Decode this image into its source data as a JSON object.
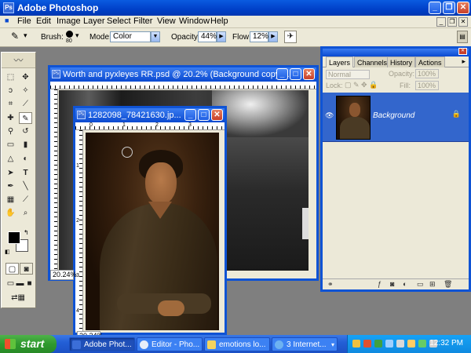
{
  "app": {
    "title": "Adobe Photoshop",
    "icon_letters": "Ps"
  },
  "menu": [
    "File",
    "Edit",
    "Image",
    "Layer",
    "Select",
    "Filter",
    "View",
    "Window",
    "Help"
  ],
  "options": {
    "brush_label": "Brush:",
    "brush_size": "80",
    "mode_label": "Mode:",
    "mode_value": "Color",
    "opacity_label": "Opacity:",
    "opacity_value": "44%",
    "flow_label": "Flow:",
    "flow_value": "12%"
  },
  "document_back": {
    "title": "Worth and pyxleyes RR.psd @ 20.2% (Background copy ..."
  },
  "document_front": {
    "title": "1282098_78421630.jp...",
    "zoom": "20.24%",
    "ruler_h": [
      "0",
      "1",
      "2",
      "3"
    ],
    "ruler_v": [
      "1",
      "2",
      "3",
      "4"
    ]
  },
  "layers_palette": {
    "tabs": [
      "Layers",
      "Channels",
      "History",
      "Actions"
    ],
    "blend_mode": "Normal",
    "opacity_label": "Opacity:",
    "opacity_value": "100%",
    "lock_label": "Lock:",
    "fill_label": "Fill:",
    "fill_value": "100%",
    "layer_name": "Background"
  },
  "taskbar": {
    "start": "start",
    "tasks": [
      "Adobe Phot...",
      "Editor - Pho...",
      "emotions lo...",
      "3 Internet..."
    ],
    "clock": "12:32 PM"
  },
  "colors": {
    "xp_blue": "#0f53d4",
    "layer_selected": "#3366cc",
    "taskbar": "#235fd6",
    "start_green": "#2f9a2e"
  }
}
